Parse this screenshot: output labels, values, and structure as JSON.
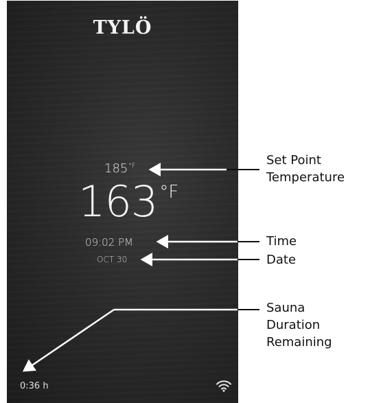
{
  "device": {
    "logo": "TYLÖ",
    "setpoint_value": "185",
    "setpoint_unit": "°F",
    "current_value": "163",
    "current_unit": "°F",
    "time": "09:02 PM",
    "date": "OCT 30",
    "duration": "0:36 h",
    "wifi_icon": "wifi-icon"
  },
  "callouts": {
    "setpoint_line1": "Set Point",
    "setpoint_line2": "Temperature",
    "time": "Time",
    "date": "Date",
    "duration_line1": "Sauna",
    "duration_line2": "Duration",
    "duration_line3": "Remaining"
  }
}
